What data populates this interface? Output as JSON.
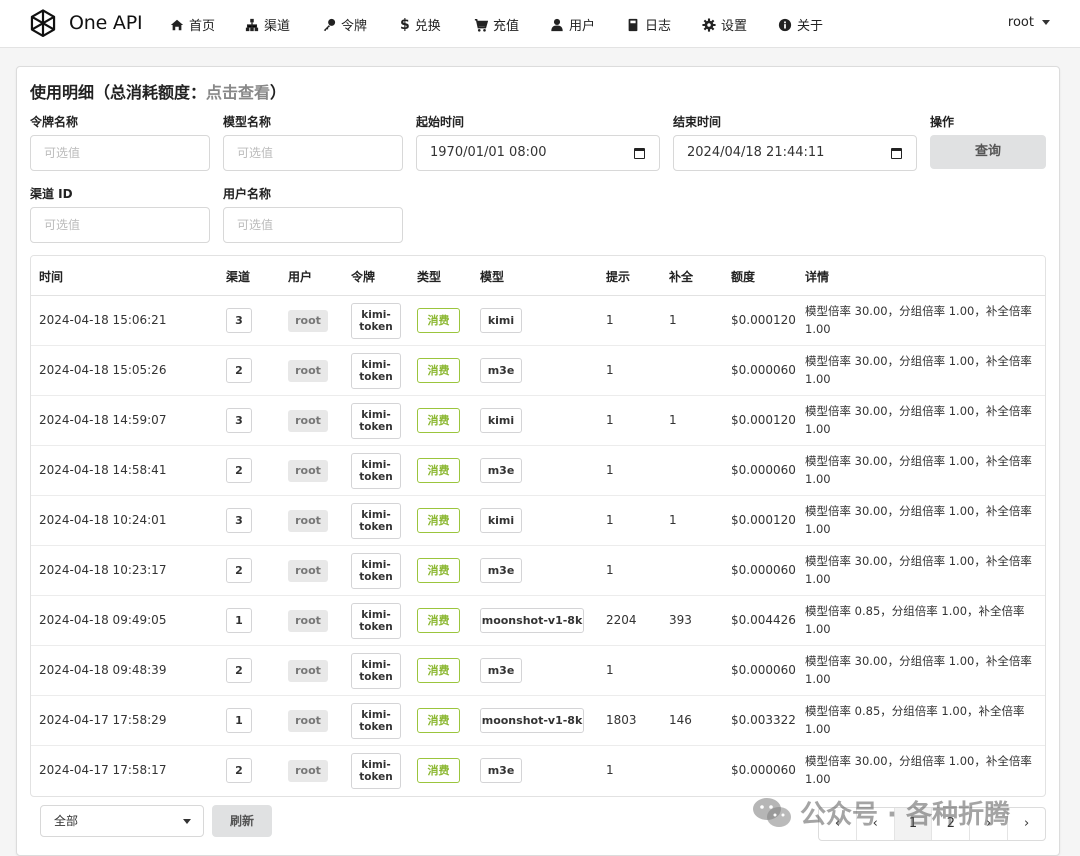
{
  "app": {
    "name": "One API"
  },
  "nav": [
    {
      "label": "首页",
      "icon": "home-icon"
    },
    {
      "label": "渠道",
      "icon": "sitemap-icon"
    },
    {
      "label": "令牌",
      "icon": "key-icon"
    },
    {
      "label": "兑换",
      "icon": "dollar-icon"
    },
    {
      "label": "充值",
      "icon": "cart-icon"
    },
    {
      "label": "用户",
      "icon": "user-icon"
    },
    {
      "label": "日志",
      "icon": "book-icon"
    },
    {
      "label": "设置",
      "icon": "gear-icon"
    },
    {
      "label": "关于",
      "icon": "info-icon"
    }
  ],
  "user_menu": {
    "label": "root"
  },
  "page": {
    "title": "使用明细（总消耗额度：",
    "title_link": "点击查看",
    "title_end": "）"
  },
  "filters": {
    "token_name": {
      "label": "令牌名称",
      "placeholder": "可选值"
    },
    "model_name": {
      "label": "模型名称",
      "placeholder": "可选值"
    },
    "start_time": {
      "label": "起始时间",
      "value": "1970/01/01 08:00"
    },
    "end_time": {
      "label": "结束时间",
      "value": "2024/04/18 21:44:11"
    },
    "action": {
      "label": "操作",
      "button": "查询"
    },
    "channel_id": {
      "label": "渠道 ID",
      "placeholder": "可选值"
    },
    "username": {
      "label": "用户名称",
      "placeholder": "可选值"
    }
  },
  "table": {
    "headers": [
      "时间",
      "渠道",
      "用户",
      "令牌",
      "类型",
      "模型",
      "提示",
      "补全",
      "额度",
      "详情"
    ],
    "rows": [
      {
        "time": "2024-04-18 15:06:21",
        "channel": "3",
        "user": "root",
        "token": "kimi-token",
        "type": "消费",
        "model": "kimi",
        "prompt": "1",
        "completion": "1",
        "quota": "$0.000120",
        "detail": "模型倍率 30.00，分组倍率 1.00，补全倍率 1.00"
      },
      {
        "time": "2024-04-18 15:05:26",
        "channel": "2",
        "user": "root",
        "token": "kimi-token",
        "type": "消费",
        "model": "m3e",
        "prompt": "1",
        "completion": "",
        "quota": "$0.000060",
        "detail": "模型倍率 30.00，分组倍率 1.00，补全倍率 1.00"
      },
      {
        "time": "2024-04-18 14:59:07",
        "channel": "3",
        "user": "root",
        "token": "kimi-token",
        "type": "消费",
        "model": "kimi",
        "prompt": "1",
        "completion": "1",
        "quota": "$0.000120",
        "detail": "模型倍率 30.00，分组倍率 1.00，补全倍率 1.00"
      },
      {
        "time": "2024-04-18 14:58:41",
        "channel": "2",
        "user": "root",
        "token": "kimi-token",
        "type": "消费",
        "model": "m3e",
        "prompt": "1",
        "completion": "",
        "quota": "$0.000060",
        "detail": "模型倍率 30.00，分组倍率 1.00，补全倍率 1.00"
      },
      {
        "time": "2024-04-18 10:24:01",
        "channel": "3",
        "user": "root",
        "token": "kimi-token",
        "type": "消费",
        "model": "kimi",
        "prompt": "1",
        "completion": "1",
        "quota": "$0.000120",
        "detail": "模型倍率 30.00，分组倍率 1.00，补全倍率 1.00"
      },
      {
        "time": "2024-04-18 10:23:17",
        "channel": "2",
        "user": "root",
        "token": "kimi-token",
        "type": "消费",
        "model": "m3e",
        "prompt": "1",
        "completion": "",
        "quota": "$0.000060",
        "detail": "模型倍率 30.00，分组倍率 1.00，补全倍率 1.00"
      },
      {
        "time": "2024-04-18 09:49:05",
        "channel": "1",
        "user": "root",
        "token": "kimi-token",
        "type": "消费",
        "model": "moonshot-v1-8k",
        "prompt": "2204",
        "completion": "393",
        "quota": "$0.004426",
        "detail": "模型倍率 0.85，分组倍率 1.00，补全倍率 1.00"
      },
      {
        "time": "2024-04-18 09:48:39",
        "channel": "2",
        "user": "root",
        "token": "kimi-token",
        "type": "消费",
        "model": "m3e",
        "prompt": "1",
        "completion": "",
        "quota": "$0.000060",
        "detail": "模型倍率 30.00，分组倍率 1.00，补全倍率 1.00"
      },
      {
        "time": "2024-04-17 17:58:29",
        "channel": "1",
        "user": "root",
        "token": "kimi-token",
        "type": "消费",
        "model": "moonshot-v1-8k",
        "prompt": "1803",
        "completion": "146",
        "quota": "$0.003322",
        "detail": "模型倍率 0.85，分组倍率 1.00，补全倍率 1.00"
      },
      {
        "time": "2024-04-17 17:58:17",
        "channel": "2",
        "user": "root",
        "token": "kimi-token",
        "type": "消费",
        "model": "m3e",
        "prompt": "1",
        "completion": "",
        "quota": "$0.000060",
        "detail": "模型倍率 30.00，分组倍率 1.00，补全倍率 1.00"
      }
    ]
  },
  "footer": {
    "log_type_select": "全部",
    "refresh_button": "刷新",
    "pagination": [
      "‹",
      "‹",
      "1",
      "2",
      "›",
      "›"
    ]
  },
  "watermark": {
    "text": "公众号 · 各种折腾"
  },
  "colors": {
    "type_label_border": "#9bc53d",
    "type_label_text": "#8cb832",
    "button_bg": "#e0e1e2"
  }
}
